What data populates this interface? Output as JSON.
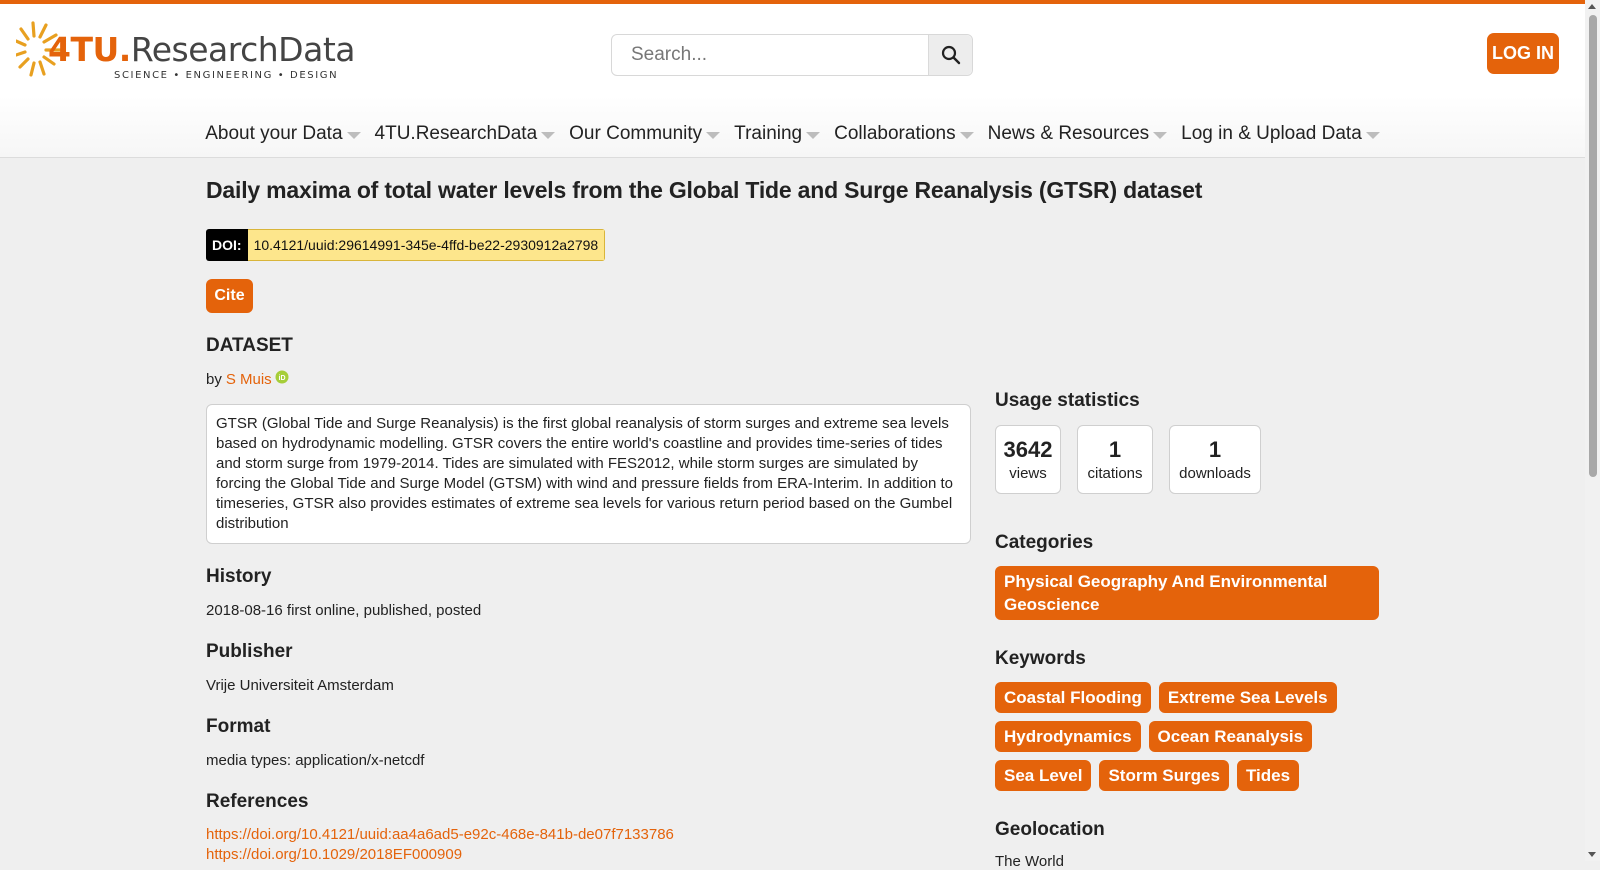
{
  "header": {
    "logo": {
      "brand_accent": "4TU.",
      "brand_rest": "ResearchData",
      "tagline": "SCIENCE • ENGINEERING • DESIGN"
    },
    "search": {
      "placeholder": "Search...",
      "icon": "search-icon"
    },
    "login_label": "LOG IN"
  },
  "nav": {
    "items": [
      {
        "label": "About your Data"
      },
      {
        "label": "4TU.ResearchData"
      },
      {
        "label": "Our Community"
      },
      {
        "label": "Training"
      },
      {
        "label": "Collaborations"
      },
      {
        "label": "News & Resources"
      },
      {
        "label": "Log in & Upload Data"
      }
    ]
  },
  "dataset": {
    "title": "Daily maxima of total water levels from the Global Tide and Surge Reanalysis (GTSR) dataset",
    "doi_label": "DOI:",
    "doi_value": "10.4121/uuid:29614991-345e-4ffd-be22-2930912a2798",
    "cite_label": "Cite",
    "item_type": "DATASET",
    "by_prefix": "by",
    "author": "S Muis",
    "description": "GTSR (Global Tide and Surge Reanalysis) is the first global reanalysis of storm surges and extreme sea levels based on hydrodynamic modelling. GTSR covers the entire world's coastline and provides time-series of tides and storm surge from 1979-2014. Tides are simulated with FES2012, while storm surges are simulated by forcing the Global Tide and Surge Model (GTSM) with wind and pressure fields from ERA-Interim. In addition to timeseries, GTSR also provides estimates of extreme sea levels for various return period based on the Gumbel distribution",
    "history_heading": "History",
    "history_value": "2018-08-16 first online, published, posted",
    "publisher_heading": "Publisher",
    "publisher_value": "Vrije Universiteit Amsterdam",
    "format_heading": "Format",
    "format_value": "media types: application/x-netcdf",
    "references_heading": "References",
    "references": [
      "https://doi.org/10.4121/uuid:aa4a6ad5-e92c-468e-841b-de07f7133786",
      "https://doi.org/10.1029/2018EF000909"
    ]
  },
  "sidebar": {
    "usage_heading": "Usage statistics",
    "stats": [
      {
        "number": "3642",
        "label": "views"
      },
      {
        "number": "1",
        "label": "citations"
      },
      {
        "number": "1",
        "label": "downloads"
      }
    ],
    "categories_heading": "Categories",
    "categories": [
      "Physical Geography And Environmental Geoscience"
    ],
    "keywords_heading": "Keywords",
    "keywords": [
      "Coastal Flooding",
      "Extreme Sea Levels",
      "Hydrodynamics",
      "Ocean Reanalysis",
      "Sea Level",
      "Storm Surges",
      "Tides"
    ],
    "geolocation_heading": "Geolocation",
    "geolocation_value": "The World"
  },
  "colors": {
    "accent": "#e4630b",
    "doi_bg": "#fde68c",
    "page_bg": "#efefef"
  }
}
